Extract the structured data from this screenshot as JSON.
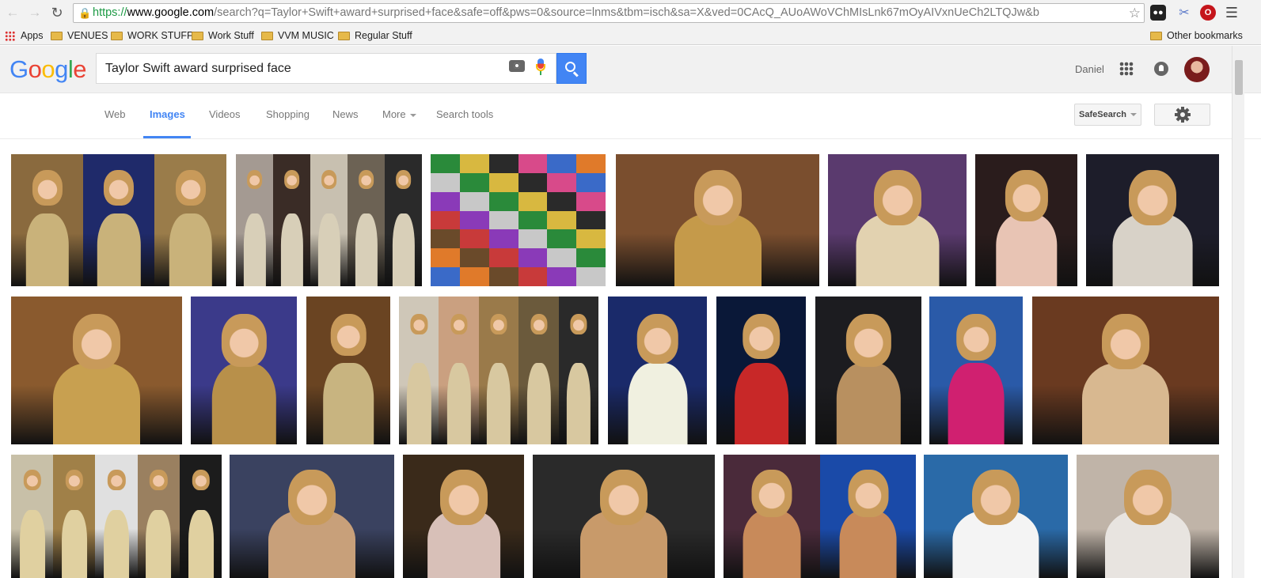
{
  "browser": {
    "url_scheme": "https://",
    "url_host": "www.google.com",
    "url_path": "/search?q=Taylor+Swift+award+surprised+face&safe=off&pws=0&source=lnms&tbm=isch&sa=X&ved=0CAcQ_AUoAWoVChMIsLnk67mOyAIVxnUeCh2LTQJw&b",
    "bookmarks": [
      {
        "label": "Apps",
        "icon": "apps-grid-icon"
      },
      {
        "label": "VENUES",
        "icon": "folder-icon"
      },
      {
        "label": "WORK STUFF",
        "icon": "folder-icon"
      },
      {
        "label": "Work Stuff",
        "icon": "folder-icon"
      },
      {
        "label": "VVM MUSIC",
        "icon": "folder-icon"
      },
      {
        "label": "Regular Stuff",
        "icon": "folder-icon"
      }
    ],
    "other_bookmarks": "Other bookmarks"
  },
  "header": {
    "logo": "Google",
    "query": "Taylor Swift award surprised face",
    "user_name": "Daniel"
  },
  "tabs": [
    {
      "label": "Web",
      "active": false
    },
    {
      "label": "Images",
      "active": true
    },
    {
      "label": "Videos",
      "active": false
    },
    {
      "label": "Shopping",
      "active": false
    },
    {
      "label": "News",
      "active": false
    },
    {
      "label": "More",
      "active": false
    },
    {
      "label": "Search tools",
      "active": false
    }
  ],
  "tools": {
    "safesearch_label": "SafeSearch"
  },
  "colors": {
    "accent": "#4285f4",
    "logo": [
      "#4285f4",
      "#ea4335",
      "#fbbc05",
      "#4285f4",
      "#34a853",
      "#ea4335"
    ]
  },
  "results_rows": [
    [
      {
        "panels": [
          "#8a6a3e",
          "#1f2a6a",
          "#9a7c4a"
        ],
        "dress": "#c9b27a"
      },
      {
        "panels": [
          "#a49a92",
          "#3a2c26",
          "#c8c0b0",
          "#6c6254",
          "#2a2a2a"
        ],
        "dress": "#d8cfb8"
      },
      {
        "collage": true,
        "dress": "#888"
      },
      {
        "panels": [
          "#7a4e2e"
        ],
        "dress": "#c59a4a"
      },
      {
        "panels": [
          "#5a3a6e"
        ],
        "dress": "#e2d2b0"
      },
      {
        "panels": [
          "#2a1c1c"
        ],
        "dress": "#e8c4b4"
      },
      {
        "panels": [
          "#1d1d2a"
        ],
        "dress": "#d8d2c8"
      }
    ],
    [
      {
        "panels": [
          "#8a5a2e"
        ],
        "dress": "#c8a050"
      },
      {
        "panels": [
          "#3b3a8a"
        ],
        "dress": "#b8904a"
      },
      {
        "panels": [
          "#6a4422"
        ],
        "dress": "#c8b480"
      },
      {
        "panels": [
          "#cfc7b8",
          "#caa080",
          "#9a7a4a",
          "#6b5a3c",
          "#2a2a2a"
        ],
        "dress": "#d8c8a0"
      },
      {
        "panels": [
          "#1a2a6a"
        ],
        "dress": "#f0f0e0"
      },
      {
        "panels": [
          "#0a1838"
        ],
        "dress": "#c82828"
      },
      {
        "panels": [
          "#1c1c20"
        ],
        "dress": "#b89060"
      },
      {
        "panels": [
          "#2a5aa8"
        ],
        "dress": "#d02070"
      },
      {
        "panels": [
          "#6a3a20"
        ],
        "dress": "#d8b890"
      }
    ],
    [
      {
        "panels": [
          "#c8c0a8",
          "#a08048",
          "#e0e0e0",
          "#9a8060",
          "#1c1c1c"
        ],
        "dress": "#e0d0a0"
      },
      {
        "panels": [
          "#3a4260"
        ],
        "dress": "#c8a07a"
      },
      {
        "panels": [
          "#3a2a1a"
        ],
        "dress": "#d8c0b8"
      },
      {
        "panels": [
          "#2a2a2a"
        ],
        "dress": "#c89a6a"
      },
      {
        "panels": [
          "#4a2a3a",
          "#1a4aa8"
        ],
        "dress": "#c88a5a"
      },
      {
        "panels": [
          "#2a6aa8"
        ],
        "dress": "#f4f4f4"
      },
      {
        "panels": [
          "#c0b4a8"
        ],
        "dress": "#e8e4e0"
      }
    ]
  ]
}
